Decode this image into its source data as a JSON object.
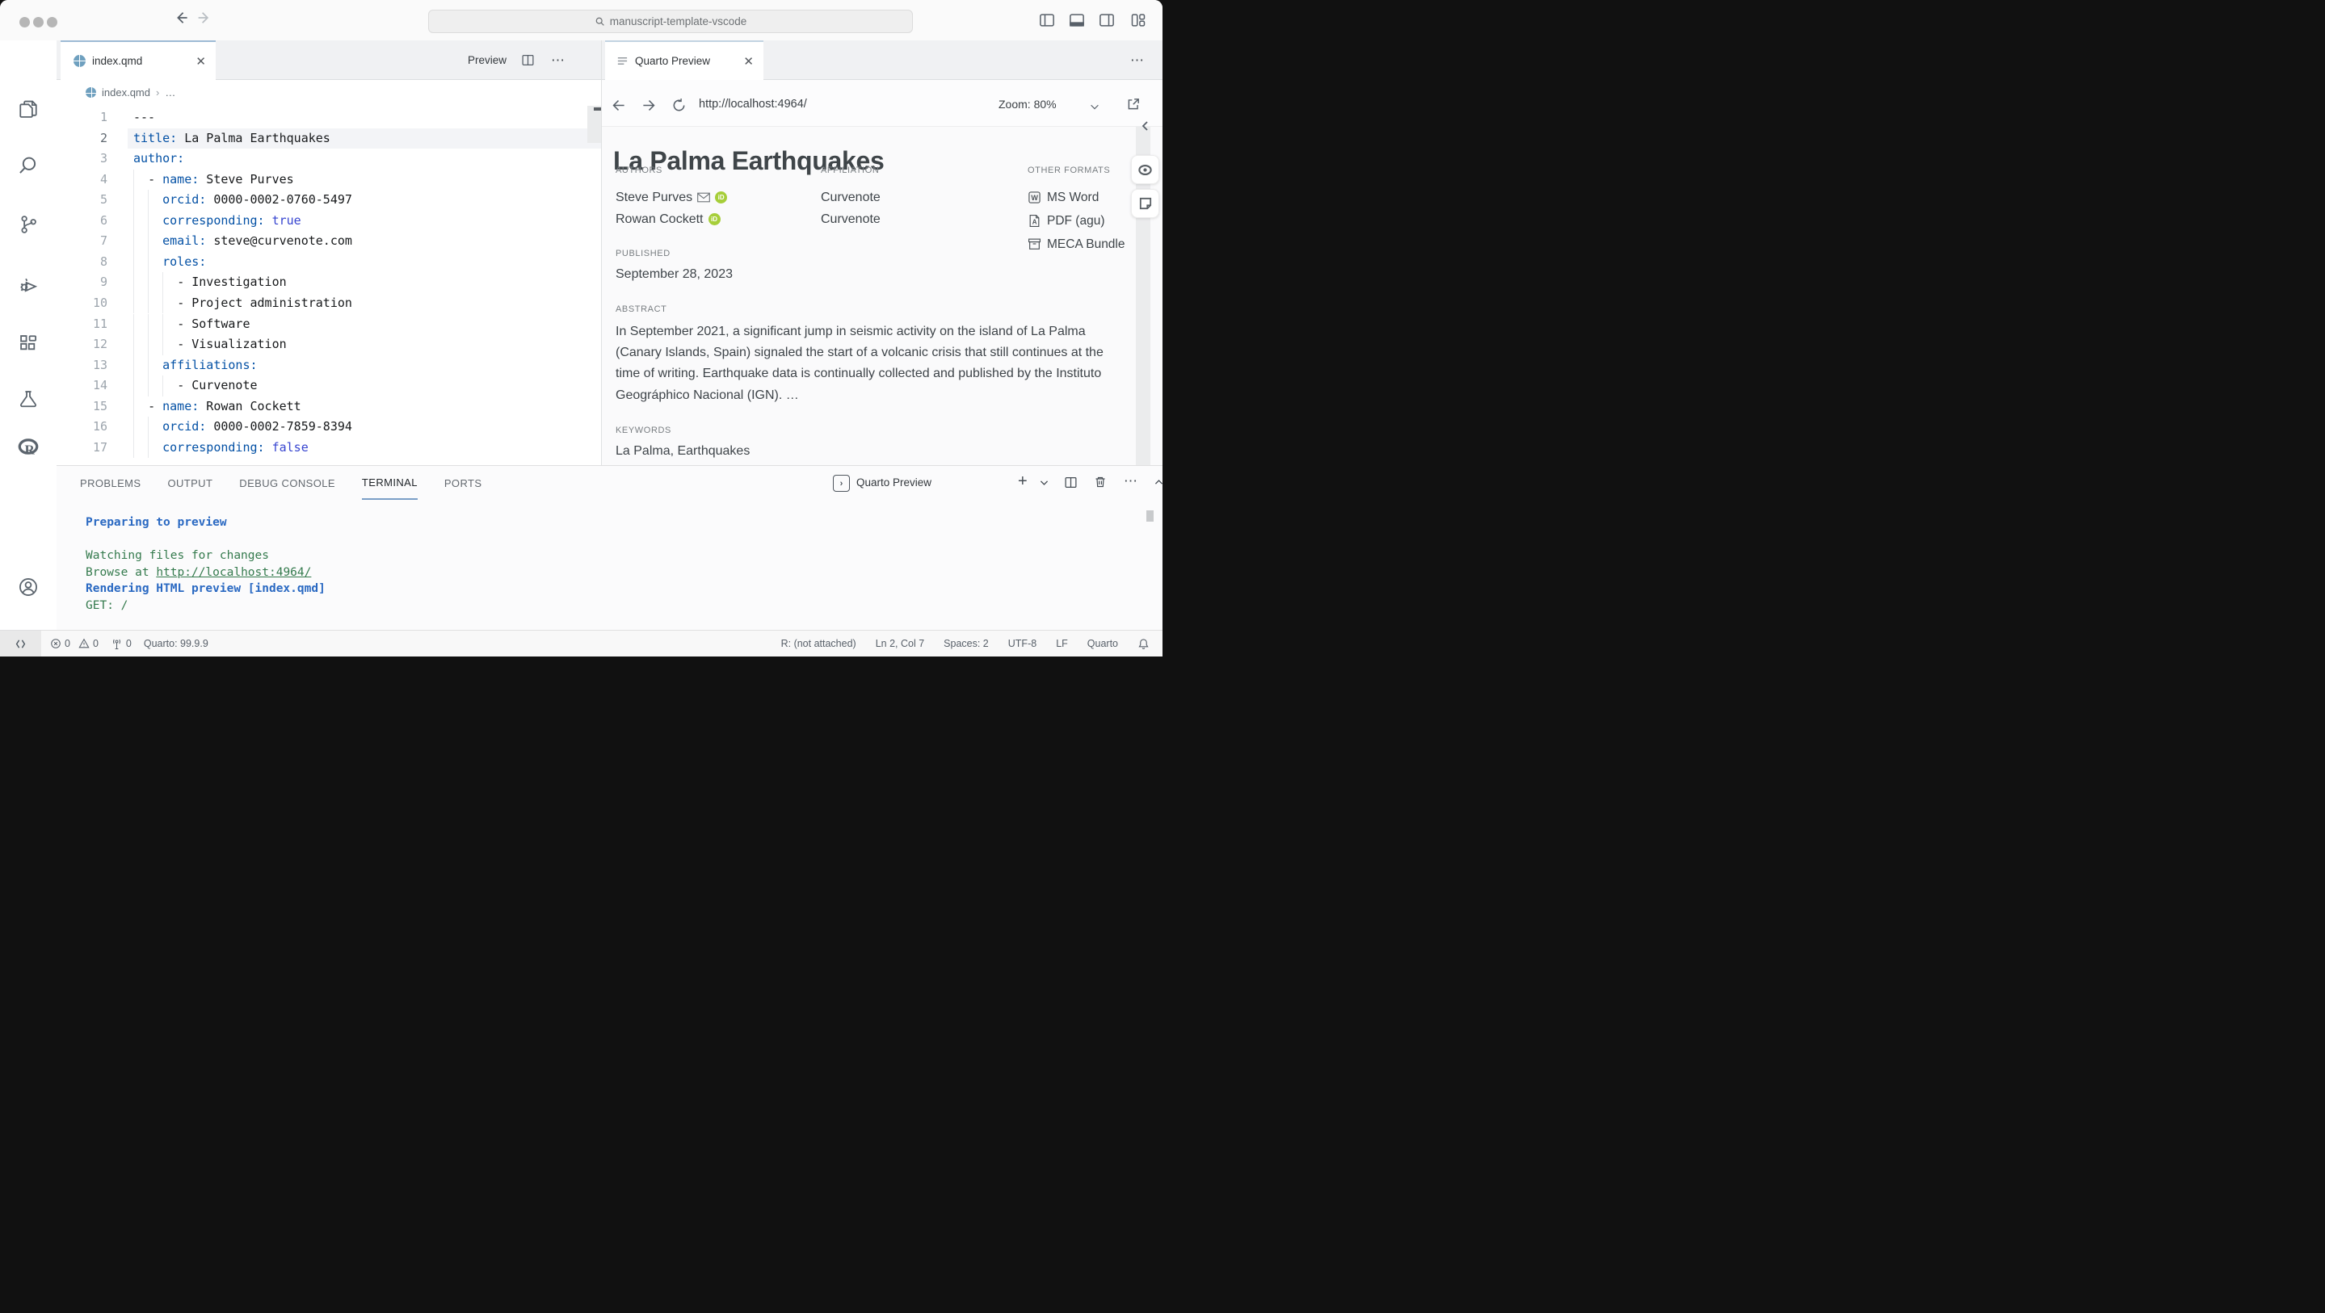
{
  "title_bar": {
    "search": "manuscript-template-vscode"
  },
  "editor": {
    "tab": {
      "label": "index.qmd"
    },
    "actions": {
      "preview_label": "Preview"
    },
    "breadcrumb": {
      "file": "index.qmd",
      "more": "…"
    },
    "code": {
      "active_line": 2,
      "lines": [
        {
          "n": 1,
          "indent": 0,
          "tokens": [
            {
              "t": "---",
              "c": "plain"
            }
          ]
        },
        {
          "n": 2,
          "indent": 0,
          "tokens": [
            {
              "t": "title:",
              "c": "key"
            },
            {
              "t": " La Palma Earthquakes",
              "c": "plain"
            }
          ]
        },
        {
          "n": 3,
          "indent": 0,
          "tokens": [
            {
              "t": "author:",
              "c": "key"
            }
          ]
        },
        {
          "n": 4,
          "indent": 2,
          "tokens": [
            {
              "t": "- ",
              "c": "plain"
            },
            {
              "t": "name:",
              "c": "key"
            },
            {
              "t": " Steve Purves",
              "c": "plain"
            }
          ]
        },
        {
          "n": 5,
          "indent": 4,
          "tokens": [
            {
              "t": "orcid:",
              "c": "key"
            },
            {
              "t": " 0000-0002-0760-5497",
              "c": "plain"
            }
          ]
        },
        {
          "n": 6,
          "indent": 4,
          "tokens": [
            {
              "t": "corresponding:",
              "c": "key"
            },
            {
              "t": " ",
              "c": "plain"
            },
            {
              "t": "true",
              "c": "bool"
            }
          ]
        },
        {
          "n": 7,
          "indent": 4,
          "tokens": [
            {
              "t": "email:",
              "c": "key"
            },
            {
              "t": " steve@curvenote.com",
              "c": "plain"
            }
          ]
        },
        {
          "n": 8,
          "indent": 4,
          "tokens": [
            {
              "t": "roles:",
              "c": "key"
            }
          ]
        },
        {
          "n": 9,
          "indent": 6,
          "tokens": [
            {
              "t": "- Investigation",
              "c": "plain"
            }
          ]
        },
        {
          "n": 10,
          "indent": 6,
          "tokens": [
            {
              "t": "- Project administration",
              "c": "plain"
            }
          ]
        },
        {
          "n": 11,
          "indent": 6,
          "tokens": [
            {
              "t": "- Software",
              "c": "plain"
            }
          ]
        },
        {
          "n": 12,
          "indent": 6,
          "tokens": [
            {
              "t": "- Visualization",
              "c": "plain"
            }
          ]
        },
        {
          "n": 13,
          "indent": 4,
          "tokens": [
            {
              "t": "affiliations:",
              "c": "key"
            }
          ]
        },
        {
          "n": 14,
          "indent": 6,
          "tokens": [
            {
              "t": "- Curvenote",
              "c": "plain"
            }
          ]
        },
        {
          "n": 15,
          "indent": 2,
          "tokens": [
            {
              "t": "- ",
              "c": "plain"
            },
            {
              "t": "name:",
              "c": "key"
            },
            {
              "t": " Rowan Cockett",
              "c": "plain"
            }
          ]
        },
        {
          "n": 16,
          "indent": 4,
          "tokens": [
            {
              "t": "orcid:",
              "c": "key"
            },
            {
              "t": " 0000-0002-7859-8394",
              "c": "plain"
            }
          ]
        },
        {
          "n": 17,
          "indent": 4,
          "tokens": [
            {
              "t": "corresponding:",
              "c": "key"
            },
            {
              "t": " ",
              "c": "plain"
            },
            {
              "t": "false",
              "c": "bool"
            }
          ]
        }
      ]
    }
  },
  "preview": {
    "tab": {
      "label": "Quarto Preview"
    },
    "nav": {
      "url": "http://localhost:4964/",
      "zoom_label": "Zoom: 80%"
    },
    "doc": {
      "title": "La Palma Earthquakes",
      "authors_label": "AUTHORS",
      "authors": [
        {
          "name": "Steve Purves",
          "email_icon": true,
          "orcid_icon": true
        },
        {
          "name": "Rowan Cockett",
          "email_icon": false,
          "orcid_icon": true
        }
      ],
      "affiliation_label": "AFFILIATION",
      "affiliations": [
        "Curvenote",
        "Curvenote"
      ],
      "formats_label": "OTHER FORMATS",
      "formats": [
        {
          "icon": "msword-icon",
          "label": "MS Word"
        },
        {
          "icon": "pdf-icon",
          "label": "PDF (agu)"
        },
        {
          "icon": "meca-icon",
          "label": "MECA Bundle"
        }
      ],
      "published_label": "PUBLISHED",
      "published": "September 28, 2023",
      "abstract_label": "ABSTRACT",
      "abstract": "In September 2021, a significant jump in seismic activity on the island of La Palma (Canary Islands, Spain) signaled the start of a volcanic crisis that still continues at the time of writing. Earthquake data is continually collected and published by the Instituto Geográphico Nacional (IGN). …",
      "keywords_label": "KEYWORDS",
      "keywords": "La Palma, Earthquakes"
    }
  },
  "panel": {
    "tabs": [
      {
        "label": "PROBLEMS",
        "active": false
      },
      {
        "label": "OUTPUT",
        "active": false
      },
      {
        "label": "DEBUG CONSOLE",
        "active": false
      },
      {
        "label": "TERMINAL",
        "active": true
      },
      {
        "label": "PORTS",
        "active": false
      }
    ],
    "terminal_label": "Quarto Preview",
    "terminal_lines": [
      {
        "text": "Preparing to preview",
        "color": "blue",
        "bold": true
      },
      {
        "text": "",
        "color": "green"
      },
      {
        "text": "Watching files for changes",
        "color": "green"
      },
      {
        "text": "Browse at ",
        "color": "green",
        "link": "http://localhost:4964/"
      },
      {
        "text": "Rendering HTML preview [index.qmd]",
        "color": "blue",
        "bold": true
      },
      {
        "text": "GET: /",
        "color": "green"
      }
    ]
  },
  "status_bar": {
    "errors": "0",
    "warnings": "0",
    "ports": "0",
    "quarto_version": "Quarto: 99.9.9",
    "r_status": "R: (not attached)",
    "cursor": "Ln 2, Col 7",
    "spaces": "Spaces: 2",
    "encoding": "UTF-8",
    "eol": "LF",
    "language": "Quarto"
  }
}
